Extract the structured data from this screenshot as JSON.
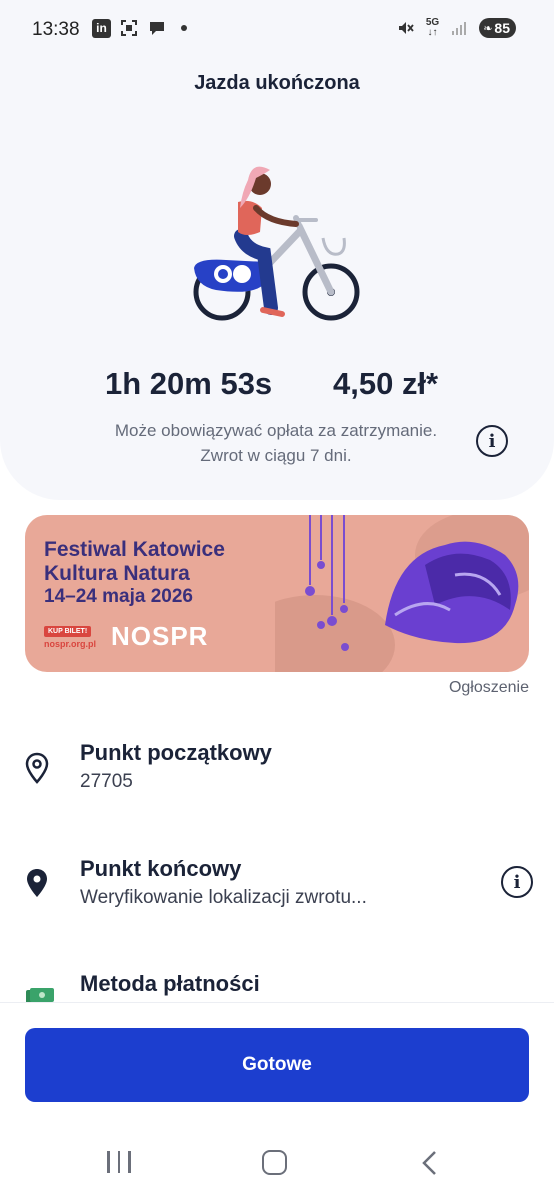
{
  "status_bar": {
    "time": "13:38",
    "left_icons": [
      "linkedin-icon",
      "screenshot-icon",
      "chat-bubble-icon",
      "dot-icon"
    ],
    "right_icons": [
      "mute-icon",
      "5g-icon",
      "signal-icon",
      "battery-icon"
    ],
    "network": "5G",
    "battery": "85"
  },
  "header": {
    "title": "Jazda ukończona"
  },
  "ride_summary": {
    "duration": "1h 20m 53s",
    "price": "4,50 zł*",
    "note_line1": "Może obowiązywać opłata za zatrzymanie.",
    "note_line2": "Zwrot w ciągu 7 dni."
  },
  "banner": {
    "line1": "Festiwal Katowice",
    "line2": "Kultura Natura",
    "line3": "14–24 maja 2026",
    "cta": "KUP BILET!",
    "url": "nospr.org.pl",
    "logo": "NOSPR",
    "ad_label": "Ogłoszenie"
  },
  "details": {
    "start": {
      "title": "Punkt początkowy",
      "value": "27705"
    },
    "end": {
      "title": "Punkt końcowy",
      "value": "Weryfikowanie lokalizacji zwrotu..."
    },
    "payment": {
      "title": "Metoda płatności"
    }
  },
  "actions": {
    "done_label": "Gotowe"
  },
  "colors": {
    "primary": "#1c3ecf",
    "text_dark": "#1b2338",
    "hero_bg": "#f6f7fb",
    "banner_bg": "#e8a898",
    "banner_text": "#3a2f7c"
  }
}
